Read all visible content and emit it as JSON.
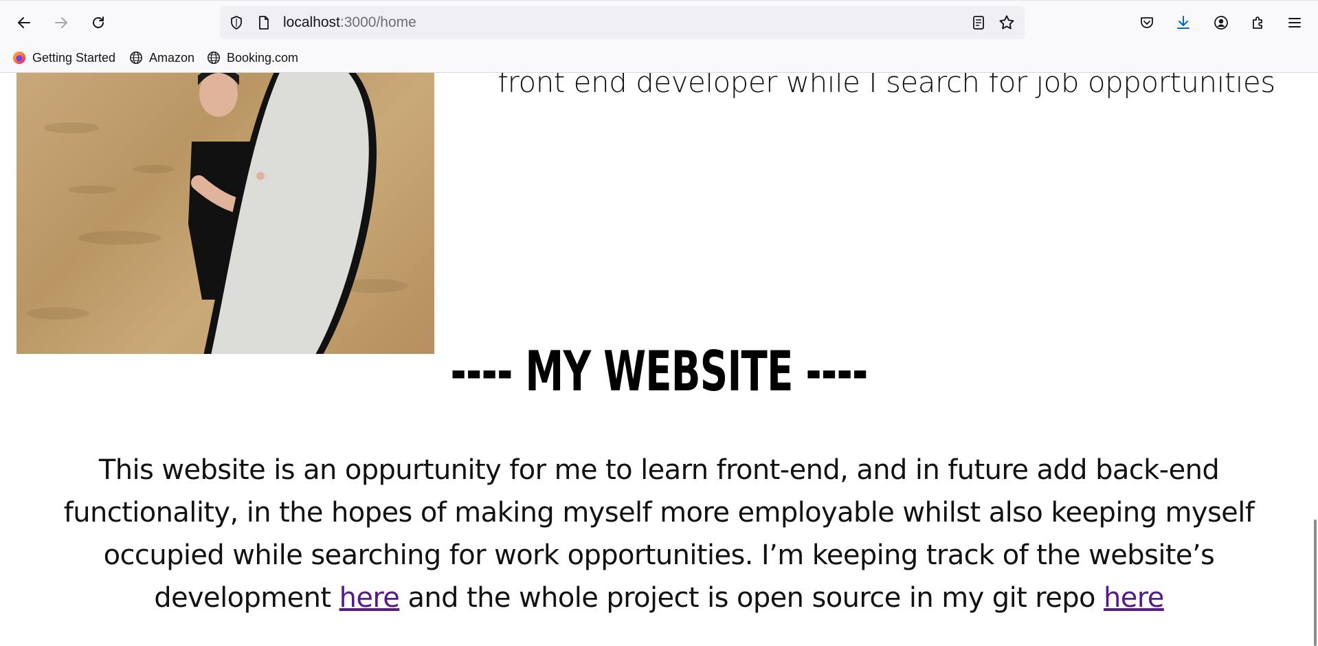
{
  "browser": {
    "url_host": "localhost",
    "url_path": ":3000/home",
    "bookmarks": [
      {
        "label": "Getting Started",
        "icon": "firefox-icon"
      },
      {
        "label": "Amazon",
        "icon": "globe-icon"
      },
      {
        "label": "Booking.com",
        "icon": "globe-icon"
      }
    ]
  },
  "about": {
    "bio_partial": "journey in the tech industry. I'm developing my skills as a front end developer while I search for job opportunities"
  },
  "website_section": {
    "title": "---- MY WEBSITE ----",
    "description_1": "This website is an oppurtunity for me to learn front-end, and in future add back-end functionality, in the hopes of making myself more employable whilst also keeping myself occupied while searching for work opportunities. I’m keeping track of the website’s development ",
    "link_1": "here",
    "description_2": " and the whole project is open source in my git repo ",
    "link_2": "here"
  },
  "colors": {
    "link_visited": "#551a8b",
    "toolbar_bg": "#f9f9fb",
    "download_icon_accent": "#0060df"
  }
}
